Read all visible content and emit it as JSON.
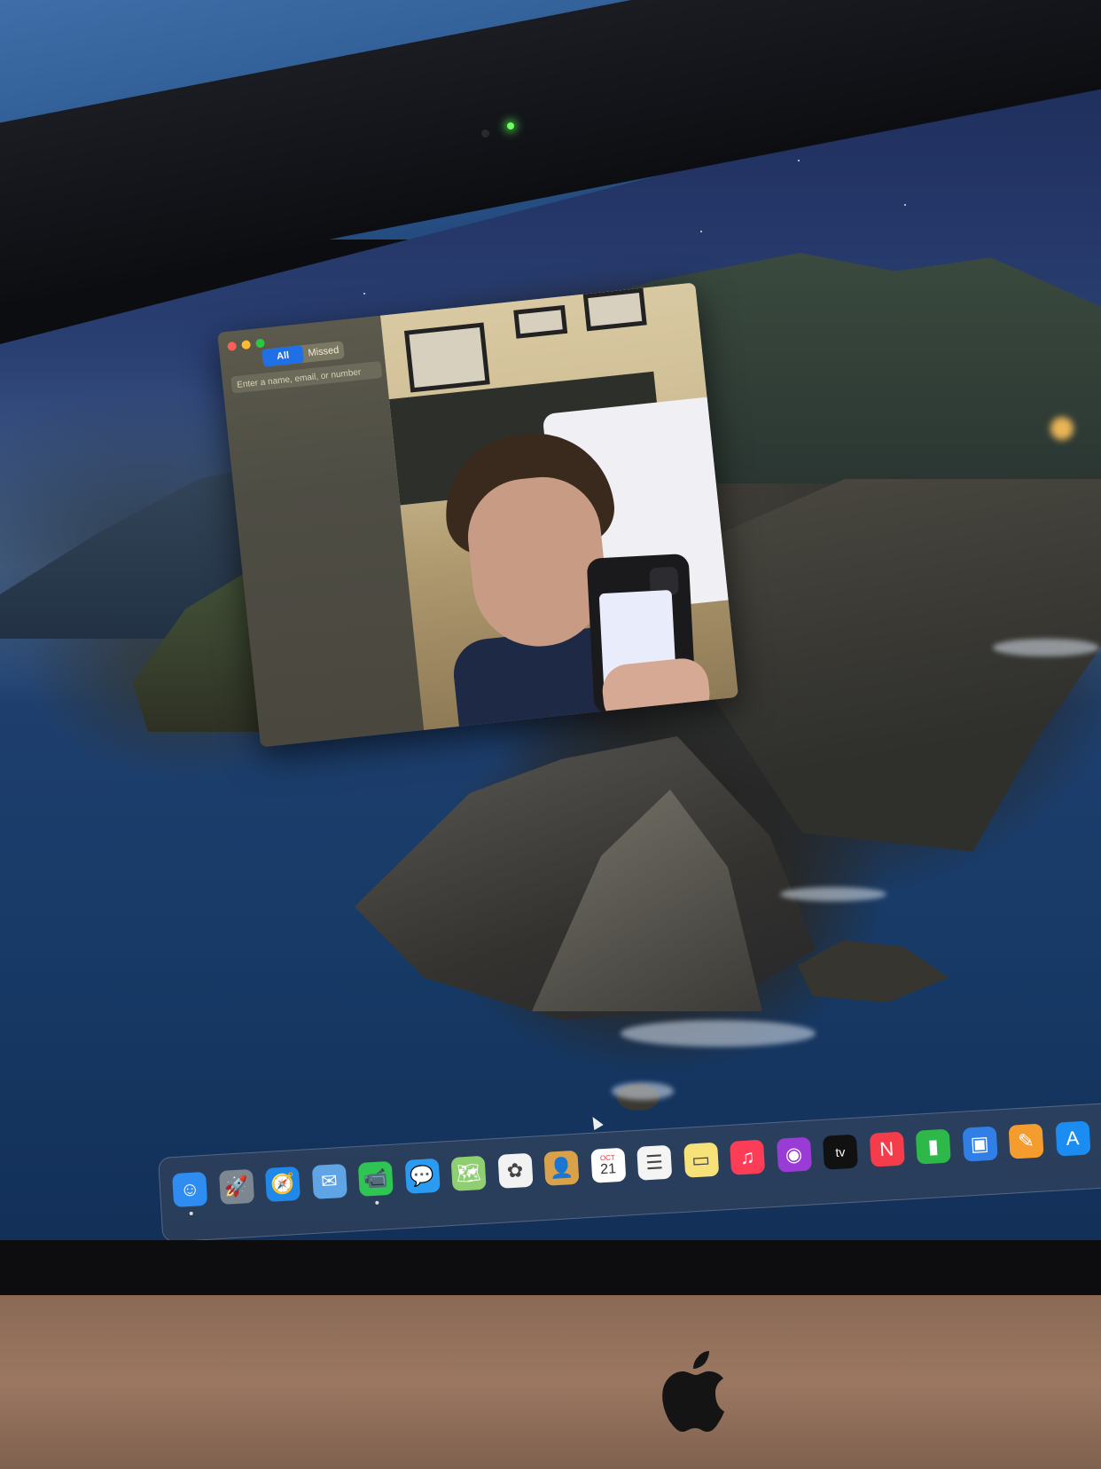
{
  "facetime": {
    "segments": {
      "all": "All",
      "missed": "Missed"
    },
    "search": {
      "placeholder": "Enter a name, email, or number"
    }
  },
  "dock": {
    "apps": [
      {
        "name": "finder",
        "icon": "finder-icon",
        "glyph": "☺",
        "color": "#2f8cf0",
        "running": true
      },
      {
        "name": "launchpad",
        "icon": "launchpad-icon",
        "glyph": "🚀",
        "color": "#7d8791",
        "running": false
      },
      {
        "name": "safari",
        "icon": "safari-icon",
        "glyph": "🧭",
        "color": "#1f88e8",
        "running": false
      },
      {
        "name": "mail",
        "icon": "mail-icon",
        "glyph": "✉",
        "color": "#5fa5e6",
        "running": false
      },
      {
        "name": "facetime",
        "icon": "facetime-icon",
        "glyph": "📹",
        "color": "#2fc553",
        "running": true
      },
      {
        "name": "messages",
        "icon": "messages-icon",
        "glyph": "💬",
        "color": "#2b9bf2",
        "running": false
      },
      {
        "name": "maps",
        "icon": "maps-icon",
        "glyph": "🗺",
        "color": "#8fcf72",
        "running": false
      },
      {
        "name": "photos",
        "icon": "photos-icon",
        "glyph": "✿",
        "color": "#f2f2f2",
        "running": false
      },
      {
        "name": "contacts",
        "icon": "contacts-icon",
        "glyph": "👤",
        "color": "#d9a24a",
        "running": false
      },
      {
        "name": "calendar",
        "icon": "calendar-icon",
        "glyph": "21",
        "color": "#ffffff",
        "running": false
      },
      {
        "name": "reminders",
        "icon": "reminders-icon",
        "glyph": "☰",
        "color": "#f4f4f4",
        "running": false
      },
      {
        "name": "notes",
        "icon": "notes-icon",
        "glyph": "▭",
        "color": "#f7e27a",
        "running": false
      },
      {
        "name": "music",
        "icon": "music-icon",
        "glyph": "♫",
        "color": "#fb3d58",
        "running": false
      },
      {
        "name": "podcasts",
        "icon": "podcasts-icon",
        "glyph": "◉",
        "color": "#9a3bd6",
        "running": false
      },
      {
        "name": "tv",
        "icon": "tv-icon",
        "glyph": "tv",
        "color": "#111111",
        "running": false
      },
      {
        "name": "news",
        "icon": "news-icon",
        "glyph": "N",
        "color": "#f43c4b",
        "running": false
      },
      {
        "name": "numbers",
        "icon": "numbers-icon",
        "glyph": "▮",
        "color": "#2fb84a",
        "running": false
      },
      {
        "name": "keynote",
        "icon": "keynote-icon",
        "glyph": "▣",
        "color": "#2f7fe6",
        "running": false
      },
      {
        "name": "pages",
        "icon": "pages-icon",
        "glyph": "✎",
        "color": "#f59c2f",
        "running": false
      },
      {
        "name": "app-store",
        "icon": "app-store-icon",
        "glyph": "A",
        "color": "#1b8cf2",
        "running": false
      }
    ],
    "calendar_month": "OCT",
    "calendar_day": "21"
  },
  "hardware": {
    "logo": "apple-logo-icon",
    "camera_led_color": "#6bff5e"
  }
}
